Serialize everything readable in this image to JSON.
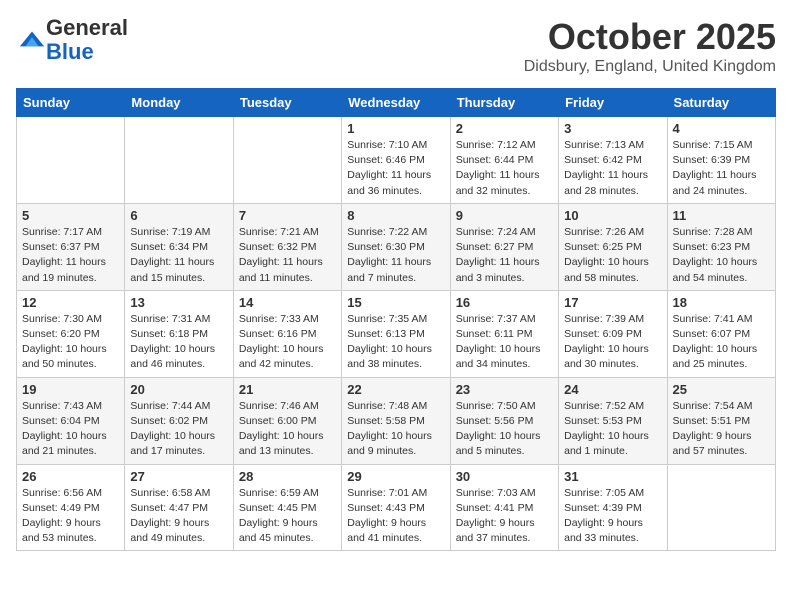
{
  "header": {
    "logo_general": "General",
    "logo_blue": "Blue",
    "month_title": "October 2025",
    "location": "Didsbury, England, United Kingdom"
  },
  "days_of_week": [
    "Sunday",
    "Monday",
    "Tuesday",
    "Wednesday",
    "Thursday",
    "Friday",
    "Saturday"
  ],
  "weeks": [
    [
      {
        "day": "",
        "info": ""
      },
      {
        "day": "",
        "info": ""
      },
      {
        "day": "",
        "info": ""
      },
      {
        "day": "1",
        "info": "Sunrise: 7:10 AM\nSunset: 6:46 PM\nDaylight: 11 hours\nand 36 minutes."
      },
      {
        "day": "2",
        "info": "Sunrise: 7:12 AM\nSunset: 6:44 PM\nDaylight: 11 hours\nand 32 minutes."
      },
      {
        "day": "3",
        "info": "Sunrise: 7:13 AM\nSunset: 6:42 PM\nDaylight: 11 hours\nand 28 minutes."
      },
      {
        "day": "4",
        "info": "Sunrise: 7:15 AM\nSunset: 6:39 PM\nDaylight: 11 hours\nand 24 minutes."
      }
    ],
    [
      {
        "day": "5",
        "info": "Sunrise: 7:17 AM\nSunset: 6:37 PM\nDaylight: 11 hours\nand 19 minutes."
      },
      {
        "day": "6",
        "info": "Sunrise: 7:19 AM\nSunset: 6:34 PM\nDaylight: 11 hours\nand 15 minutes."
      },
      {
        "day": "7",
        "info": "Sunrise: 7:21 AM\nSunset: 6:32 PM\nDaylight: 11 hours\nand 11 minutes."
      },
      {
        "day": "8",
        "info": "Sunrise: 7:22 AM\nSunset: 6:30 PM\nDaylight: 11 hours\nand 7 minutes."
      },
      {
        "day": "9",
        "info": "Sunrise: 7:24 AM\nSunset: 6:27 PM\nDaylight: 11 hours\nand 3 minutes."
      },
      {
        "day": "10",
        "info": "Sunrise: 7:26 AM\nSunset: 6:25 PM\nDaylight: 10 hours\nand 58 minutes."
      },
      {
        "day": "11",
        "info": "Sunrise: 7:28 AM\nSunset: 6:23 PM\nDaylight: 10 hours\nand 54 minutes."
      }
    ],
    [
      {
        "day": "12",
        "info": "Sunrise: 7:30 AM\nSunset: 6:20 PM\nDaylight: 10 hours\nand 50 minutes."
      },
      {
        "day": "13",
        "info": "Sunrise: 7:31 AM\nSunset: 6:18 PM\nDaylight: 10 hours\nand 46 minutes."
      },
      {
        "day": "14",
        "info": "Sunrise: 7:33 AM\nSunset: 6:16 PM\nDaylight: 10 hours\nand 42 minutes."
      },
      {
        "day": "15",
        "info": "Sunrise: 7:35 AM\nSunset: 6:13 PM\nDaylight: 10 hours\nand 38 minutes."
      },
      {
        "day": "16",
        "info": "Sunrise: 7:37 AM\nSunset: 6:11 PM\nDaylight: 10 hours\nand 34 minutes."
      },
      {
        "day": "17",
        "info": "Sunrise: 7:39 AM\nSunset: 6:09 PM\nDaylight: 10 hours\nand 30 minutes."
      },
      {
        "day": "18",
        "info": "Sunrise: 7:41 AM\nSunset: 6:07 PM\nDaylight: 10 hours\nand 25 minutes."
      }
    ],
    [
      {
        "day": "19",
        "info": "Sunrise: 7:43 AM\nSunset: 6:04 PM\nDaylight: 10 hours\nand 21 minutes."
      },
      {
        "day": "20",
        "info": "Sunrise: 7:44 AM\nSunset: 6:02 PM\nDaylight: 10 hours\nand 17 minutes."
      },
      {
        "day": "21",
        "info": "Sunrise: 7:46 AM\nSunset: 6:00 PM\nDaylight: 10 hours\nand 13 minutes."
      },
      {
        "day": "22",
        "info": "Sunrise: 7:48 AM\nSunset: 5:58 PM\nDaylight: 10 hours\nand 9 minutes."
      },
      {
        "day": "23",
        "info": "Sunrise: 7:50 AM\nSunset: 5:56 PM\nDaylight: 10 hours\nand 5 minutes."
      },
      {
        "day": "24",
        "info": "Sunrise: 7:52 AM\nSunset: 5:53 PM\nDaylight: 10 hours\nand 1 minute."
      },
      {
        "day": "25",
        "info": "Sunrise: 7:54 AM\nSunset: 5:51 PM\nDaylight: 9 hours\nand 57 minutes."
      }
    ],
    [
      {
        "day": "26",
        "info": "Sunrise: 6:56 AM\nSunset: 4:49 PM\nDaylight: 9 hours\nand 53 minutes."
      },
      {
        "day": "27",
        "info": "Sunrise: 6:58 AM\nSunset: 4:47 PM\nDaylight: 9 hours\nand 49 minutes."
      },
      {
        "day": "28",
        "info": "Sunrise: 6:59 AM\nSunset: 4:45 PM\nDaylight: 9 hours\nand 45 minutes."
      },
      {
        "day": "29",
        "info": "Sunrise: 7:01 AM\nSunset: 4:43 PM\nDaylight: 9 hours\nand 41 minutes."
      },
      {
        "day": "30",
        "info": "Sunrise: 7:03 AM\nSunset: 4:41 PM\nDaylight: 9 hours\nand 37 minutes."
      },
      {
        "day": "31",
        "info": "Sunrise: 7:05 AM\nSunset: 4:39 PM\nDaylight: 9 hours\nand 33 minutes."
      },
      {
        "day": "",
        "info": ""
      }
    ]
  ]
}
